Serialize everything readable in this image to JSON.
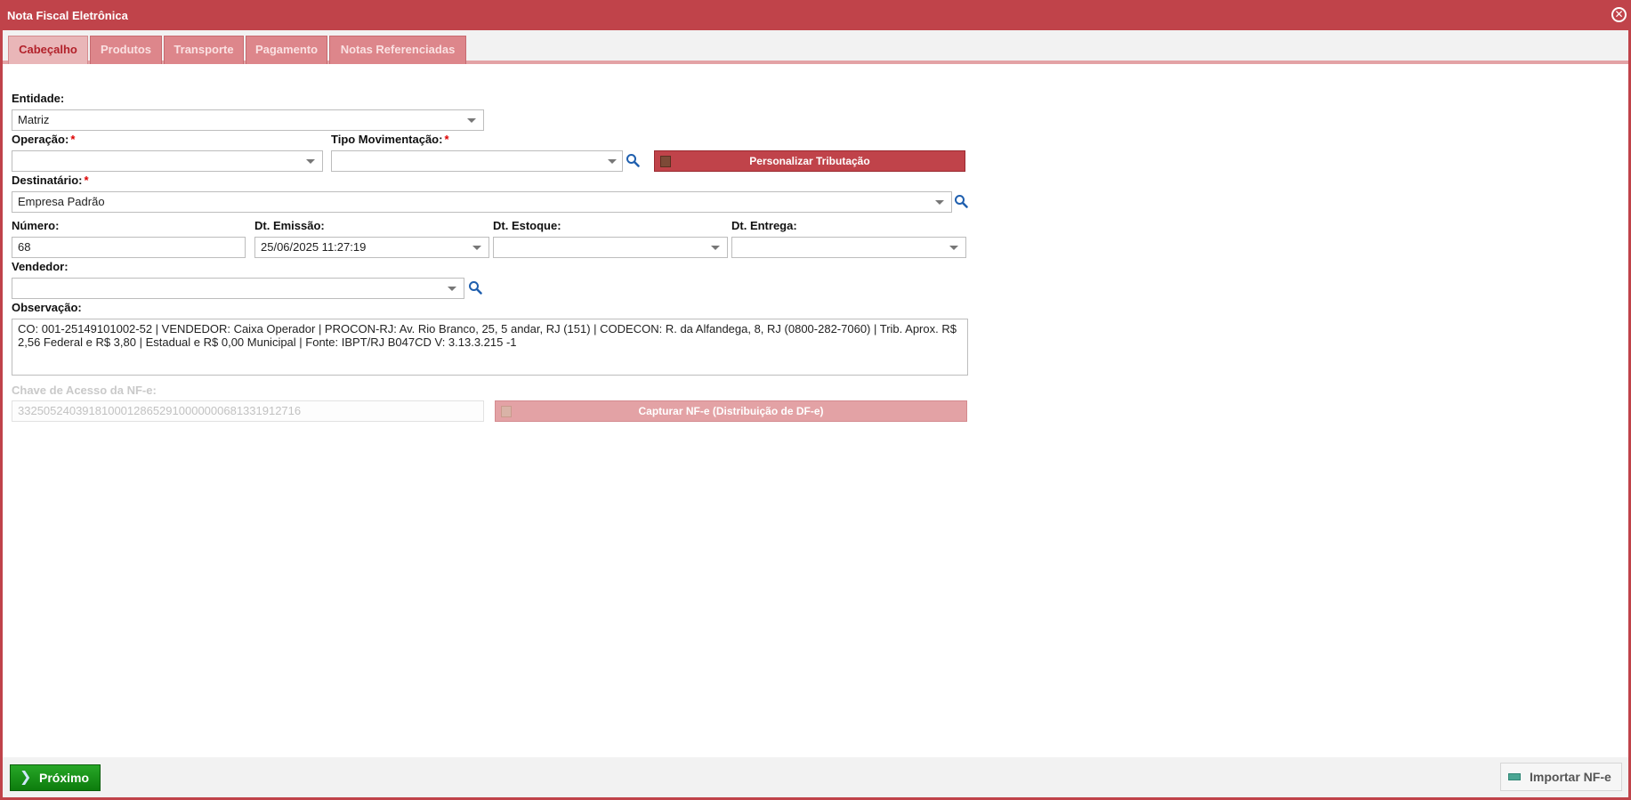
{
  "window": {
    "title": "Nota Fiscal Eletrônica"
  },
  "tabs": [
    {
      "label": "Cabeçalho",
      "active": true
    },
    {
      "label": "Produtos",
      "active": false
    },
    {
      "label": "Transporte",
      "active": false
    },
    {
      "label": "Pagamento",
      "active": false
    },
    {
      "label": "Notas Referenciadas",
      "active": false
    }
  ],
  "form": {
    "entidade": {
      "label": "Entidade:",
      "value": "Matriz"
    },
    "operacao": {
      "label": "Operação:",
      "value": "",
      "required": "*"
    },
    "tipo_movimentacao": {
      "label": "Tipo Movimentação:",
      "value": "",
      "required": "*"
    },
    "personalizar_tributacao": {
      "label": "Personalizar Tributação"
    },
    "destinatario": {
      "label": "Destinatário:",
      "value": "Empresa Padrão",
      "required": "*"
    },
    "numero": {
      "label": "Número:",
      "value": "68"
    },
    "dt_emissao": {
      "label": "Dt. Emissão:",
      "value": "25/06/2025 11:27:19"
    },
    "dt_estoque": {
      "label": "Dt. Estoque:",
      "value": ""
    },
    "dt_entrega": {
      "label": "Dt. Entrega:",
      "value": ""
    },
    "vendedor": {
      "label": "Vendedor:",
      "value": ""
    },
    "observacao": {
      "label": "Observação:",
      "value": "CO: 001-25149101002-52 | VENDEDOR: Caixa Operador | PROCON-RJ: Av. Rio Branco, 25, 5 andar, RJ (151) | CODECON: R. da Alfandega, 8, RJ (0800-282-7060) | Trib. Aprox. R$ 2,56 Federal e R$ 3,80 | Estadual e R$ 0,00 Municipal | Fonte: IBPT/RJ B047CD V: 3.13.3.215 -1"
    },
    "chave_acesso": {
      "label": "Chave de Acesso da NF-e:",
      "value": "33250524039181000128652910000000681331912716"
    },
    "capturar_nfe": {
      "label": "Capturar NF-e (Distribuição de DF-e)"
    }
  },
  "footer": {
    "next_label": "Próximo",
    "import_label": "Importar NF-e"
  },
  "icons": {
    "close": "close-icon",
    "search": "search-icon",
    "dropdown": "chevron-down-icon",
    "next": "chevron-right-icon",
    "import": "import-icon"
  },
  "colors": {
    "accent": "#c0434a",
    "tab_inactive": "#dd868b",
    "tab_active": "#e9b6b8",
    "next_green": "#1a961a"
  }
}
